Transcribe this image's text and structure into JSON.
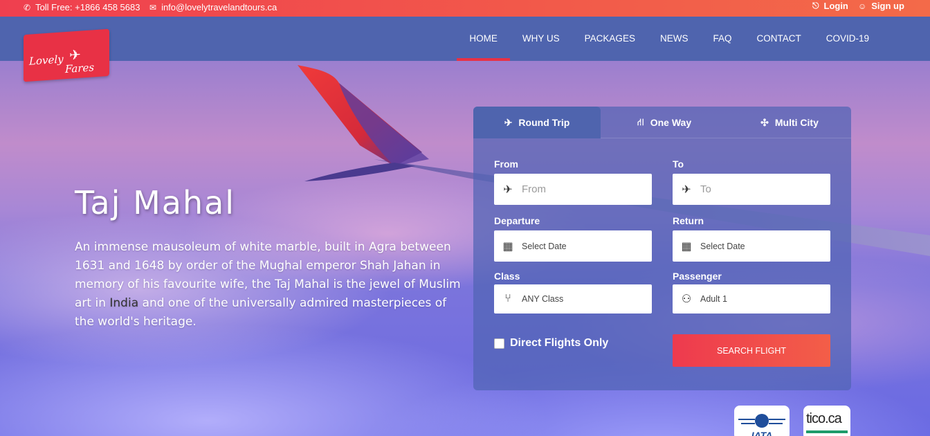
{
  "topbar": {
    "phone": "Toll Free: +1866 458 5683",
    "email": "info@lovelytravelandtours.ca",
    "login": "Login",
    "signup": "Sign up"
  },
  "logo": {
    "line1": "Lovely",
    "line2": "Fares"
  },
  "nav": {
    "items": [
      "HOME",
      "WHY US",
      "PACKAGES",
      "NEWS",
      "FAQ",
      "CONTACT",
      "COVID-19"
    ],
    "active": "HOME"
  },
  "hero": {
    "title": "Taj Mahal",
    "desc_before": "An immense mausoleum of white marble, built in Agra between 1631 and 1648 by order of the Mughal emperor Shah Jahan in memory of his favourite wife, the Taj Mahal is the jewel of Muslim art in ",
    "desc_highlight": "India",
    "desc_after": " and one of the universally admired masterpieces of the world's heritage."
  },
  "booking": {
    "tabs": [
      "Round Trip",
      "One Way",
      "Multi City"
    ],
    "active_tab": "Round Trip",
    "from_label": "From",
    "from_placeholder": "From",
    "to_label": "To",
    "to_placeholder": "To",
    "departure_label": "Departure",
    "departure_value": "Select Date",
    "return_label": "Return",
    "return_value": "Select Date",
    "class_label": "Class",
    "class_value": "ANY Class",
    "passenger_label": "Passenger",
    "passenger_value": "Adult 1",
    "direct_label": "Direct Flights Only",
    "search_label": "SEARCH FLIGHT"
  },
  "badges": {
    "iata": "IATA",
    "tico": "tico.ca"
  },
  "colors": {
    "accent": "#e83145",
    "nav": "#4f64ae",
    "panel": "#5064b4"
  }
}
